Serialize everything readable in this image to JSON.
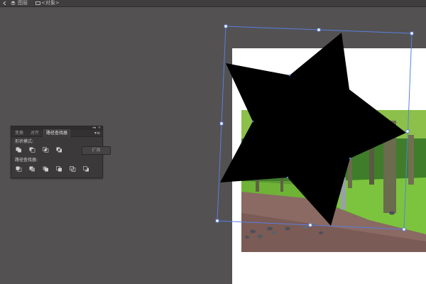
{
  "topbar": {
    "layer_label": "图层",
    "object_label": "<对象>"
  },
  "panel": {
    "tabs": [
      {
        "label": "变换",
        "active": false
      },
      {
        "label": "对齐",
        "active": false
      },
      {
        "label": "路径查找器",
        "active": true
      }
    ],
    "shape_modes_label": "形状模式:",
    "pathfinders_label": "路径查找器:",
    "expand_label": "扩展",
    "shape_mode_icons": [
      "unite-icon",
      "minus-front-icon",
      "intersect-icon",
      "exclude-icon"
    ],
    "pathfinder_icons": [
      "divide-icon",
      "trim-icon",
      "merge-icon",
      "crop-icon",
      "outline-icon",
      "minus-back-icon"
    ]
  },
  "colors": {
    "workspace": "#535152",
    "panel_bg": "#3b393a",
    "selection": "#4a6fd6",
    "star_fill": "#000000"
  }
}
